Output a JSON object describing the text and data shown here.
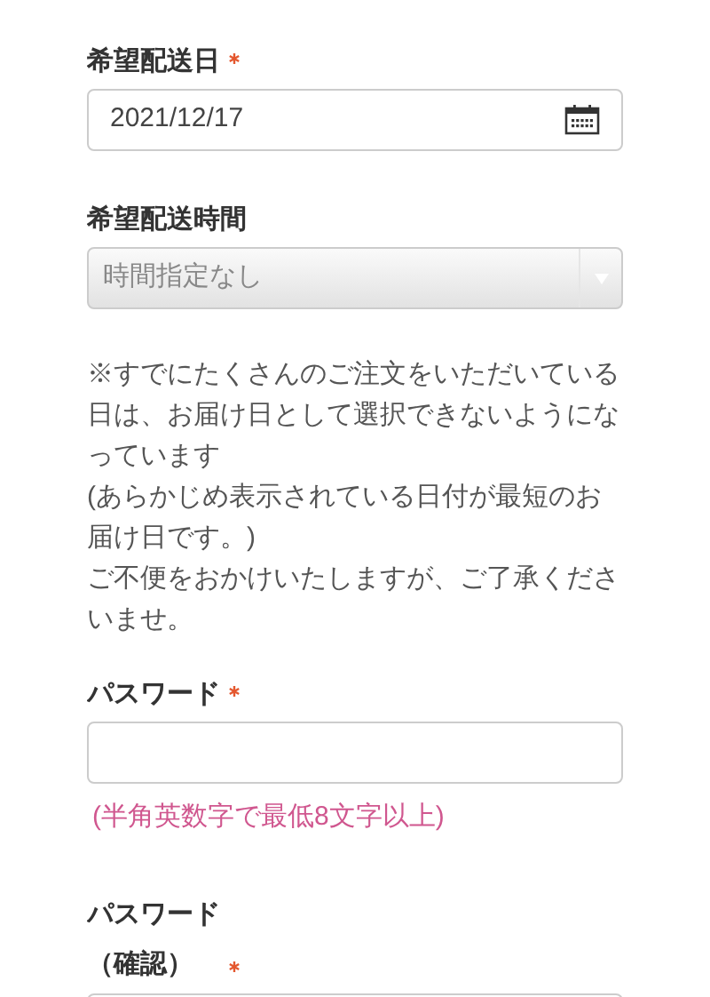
{
  "fields": [
    {
      "kind": "date",
      "label": "希望配送日",
      "required": true,
      "value": "2021/12/17"
    },
    {
      "kind": "select",
      "label": "希望配送時間",
      "required": false,
      "value": "時間指定なし"
    },
    {
      "kind": "note",
      "paragraphs": [
        "※すでにたくさんのご注文をいただいている日は、お届け日として選択できないようになっています",
        "(あらかじめ表示されている日付が最短のお届け日です。)",
        "ご不便をおかけいたしますが、ご了承くださいませ。"
      ]
    },
    {
      "kind": "password",
      "label": "パスワード",
      "required": true,
      "hint": "(半角英数字で最低8文字以上)"
    },
    {
      "kind": "password",
      "label_lines": [
        "パスワード",
        "（確認）"
      ],
      "required": true
    }
  ]
}
